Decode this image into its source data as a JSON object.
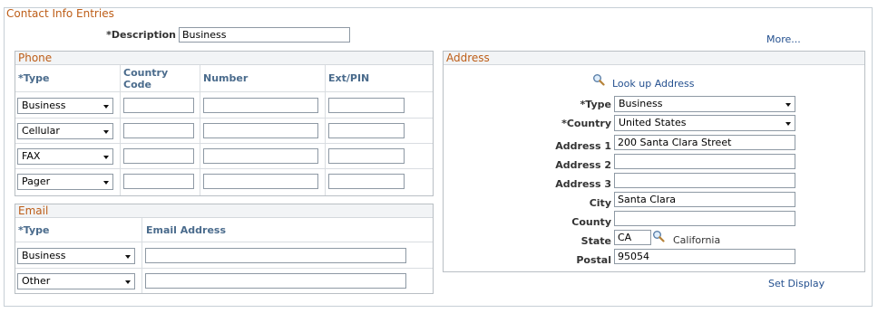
{
  "section_title": "Contact Info Entries",
  "description": {
    "label": "*Description",
    "value": "Business"
  },
  "more_link": "More...",
  "phone": {
    "title": "Phone",
    "headers": {
      "type": "*Type",
      "country_code_1": "Country",
      "country_code_2": "Code",
      "number": "Number",
      "ext": "Ext/PIN"
    },
    "rows": [
      {
        "type": "Business",
        "country_code": "",
        "number": "",
        "ext": ""
      },
      {
        "type": "Cellular",
        "country_code": "",
        "number": "",
        "ext": ""
      },
      {
        "type": "FAX",
        "country_code": "",
        "number": "",
        "ext": ""
      },
      {
        "type": "Pager",
        "country_code": "",
        "number": "",
        "ext": ""
      }
    ]
  },
  "email": {
    "title": "Email",
    "headers": {
      "type": "*Type",
      "address": "Email Address"
    },
    "rows": [
      {
        "type": "Business",
        "address": ""
      },
      {
        "type": "Other",
        "address": ""
      }
    ]
  },
  "address": {
    "title": "Address",
    "lookup_link": "Look up Address",
    "type": {
      "label": "*Type",
      "value": "Business"
    },
    "country": {
      "label": "*Country",
      "value": "United States"
    },
    "address1": {
      "label": "Address 1",
      "value": "200 Santa Clara Street"
    },
    "address2": {
      "label": "Address 2",
      "value": ""
    },
    "address3": {
      "label": "Address 3",
      "value": ""
    },
    "city": {
      "label": "City",
      "value": "Santa Clara"
    },
    "county": {
      "label": "County",
      "value": ""
    },
    "state": {
      "label": "State",
      "value": "CA",
      "description": "California"
    },
    "postal": {
      "label": "Postal",
      "value": "95054"
    }
  },
  "set_display_link": "Set Display",
  "icons": {
    "lookup": "magnifier-icon",
    "dropdown": "chevron-down-icon"
  }
}
